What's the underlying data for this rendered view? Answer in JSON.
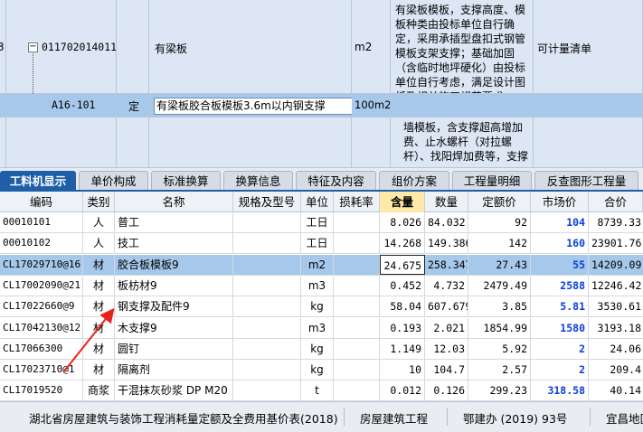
{
  "top_grid": {
    "row_number_partial": "3",
    "row1": {
      "tree_toggle": "−",
      "code": "011702014011",
      "name": "有梁板",
      "unit": "m2",
      "description": "有梁板模板，支撑高度、模板种类由投标单位自行确定，采用承插型盘扣式钢管模板支架支撑；基础加固（含临时地坪硬化）由投标单位自行考虑，满足设计图纸及相关施工规范要求。",
      "remark": "可计量清单"
    },
    "row2": {
      "code": "A16-101",
      "type": "定",
      "name_input": "有梁板胶合板模板3.6m以内钢支撑",
      "unit": "100m2"
    },
    "row3": {
      "description_partial": "墙模板，含支撑超高增加费、止水螺杆（对拉螺杆）、找阳焊加费等，支撑"
    }
  },
  "tabs": [
    {
      "label": "工料机显示",
      "active": true
    },
    {
      "label": "单价构成",
      "active": false
    },
    {
      "label": "标准换算",
      "active": false
    },
    {
      "label": "换算信息",
      "active": false
    },
    {
      "label": "特征及内容",
      "active": false
    },
    {
      "label": "组价方案",
      "active": false
    },
    {
      "label": "工程量明细",
      "active": false
    },
    {
      "label": "反查图形工程量",
      "active": false
    }
  ],
  "columns": [
    "编码",
    "类别",
    "名称",
    "规格及型号",
    "单位",
    "损耗率",
    "含量",
    "数量",
    "定额价",
    "市场价",
    "合价"
  ],
  "rows": [
    {
      "code": "00010101",
      "type": "人",
      "name": "普工",
      "spec": "",
      "unit": "工日",
      "loss": "",
      "content": "8.026",
      "qty": "84.032",
      "quota": "92",
      "market": "104",
      "total": "8739.33"
    },
    {
      "code": "00010102",
      "type": "人",
      "name": "技工",
      "spec": "",
      "unit": "工日",
      "loss": "",
      "content": "14.268",
      "qty": "149.386",
      "quota": "142",
      "market": "160",
      "total": "23901.76"
    },
    {
      "code": "CL17029710@16",
      "type": "材",
      "name": "胶合板模板9",
      "spec": "",
      "unit": "m2",
      "loss": "",
      "content": "24.675",
      "qty": "258.347",
      "quota": "27.43",
      "market": "55",
      "total": "14209.09"
    },
    {
      "code": "CL17002090@21",
      "type": "材",
      "name": "板枋材9",
      "spec": "",
      "unit": "m3",
      "loss": "",
      "content": "0.452",
      "qty": "4.732",
      "quota": "2479.49",
      "market": "2588",
      "total": "12246.42"
    },
    {
      "code": "CL17022660@9",
      "type": "材",
      "name": "钢支撑及配件9",
      "spec": "",
      "unit": "kg",
      "loss": "",
      "content": "58.04",
      "qty": "607.679",
      "quota": "3.85",
      "market": "5.81",
      "total": "3530.61"
    },
    {
      "code": "CL17042130@12",
      "type": "材",
      "name": "木支撑9",
      "spec": "",
      "unit": "m3",
      "loss": "",
      "content": "0.193",
      "qty": "2.021",
      "quota": "1854.99",
      "market": "1580",
      "total": "3193.18"
    },
    {
      "code": "CL17066300",
      "type": "材",
      "name": "圆钉",
      "spec": "",
      "unit": "kg",
      "loss": "",
      "content": "1.149",
      "qty": "12.03",
      "quota": "5.92",
      "market": "2",
      "total": "24.06"
    },
    {
      "code": "CL17023710@1",
      "type": "材",
      "name": "隔离剂",
      "spec": "",
      "unit": "kg",
      "loss": "",
      "content": "10",
      "qty": "104.7",
      "quota": "2.57",
      "market": "2",
      "total": "209.4"
    },
    {
      "code": "CL17019520",
      "type": "商浆",
      "name": "干混抹灰砂浆 DP M20",
      "spec": "",
      "unit": "t",
      "loss": "",
      "content": "0.012",
      "qty": "0.126",
      "quota": "299.23",
      "market": "318.58",
      "total": "40.14"
    }
  ],
  "status": {
    "quota_book": "湖北省房屋建筑与装饰工程消耗量定额及全费用基价表(2018)",
    "project_type": "房屋建筑工程",
    "document": "鄂建办 (2019) 93号",
    "region_partial": "宜昌地区"
  },
  "colors": {
    "selected_row": "#a6c8ea",
    "active_tab": "#1f5fa8",
    "price_blue": "#0b3fd8",
    "arrow": "#e8231b",
    "highlight_header": "#ffe9a8"
  }
}
